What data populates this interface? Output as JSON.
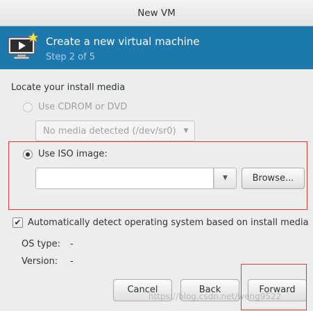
{
  "window": {
    "title": "New VM"
  },
  "banner": {
    "title": "Create a new virtual machine",
    "step": "Step 2 of 5",
    "icon": "vm-monitor-icon"
  },
  "install_media": {
    "heading": "Locate your install media",
    "cdrom_option": {
      "label": "Use CDROM or DVD",
      "selected": false,
      "enabled": false
    },
    "cdrom_combo": {
      "value": "No media detected (/dev/sr0)",
      "enabled": false
    },
    "iso_option": {
      "label": "Use ISO image:",
      "selected": true,
      "enabled": true
    },
    "iso_path": {
      "value": "",
      "placeholder": ""
    },
    "browse_label": "Browse..."
  },
  "os_detect": {
    "auto_detect_label": "Automatically detect operating system based on install media",
    "auto_detect_checked": true,
    "os_type_label": "OS type:",
    "os_type_value": "-",
    "version_label": "Version:",
    "version_value": "-"
  },
  "buttons": {
    "cancel": "Cancel",
    "back": "Back",
    "forward": "Forward"
  },
  "watermark": "https://blog.csdn.net/weng9522",
  "colors": {
    "banner_bg": "#1d78ae",
    "highlight_box": "#d63b3b"
  }
}
